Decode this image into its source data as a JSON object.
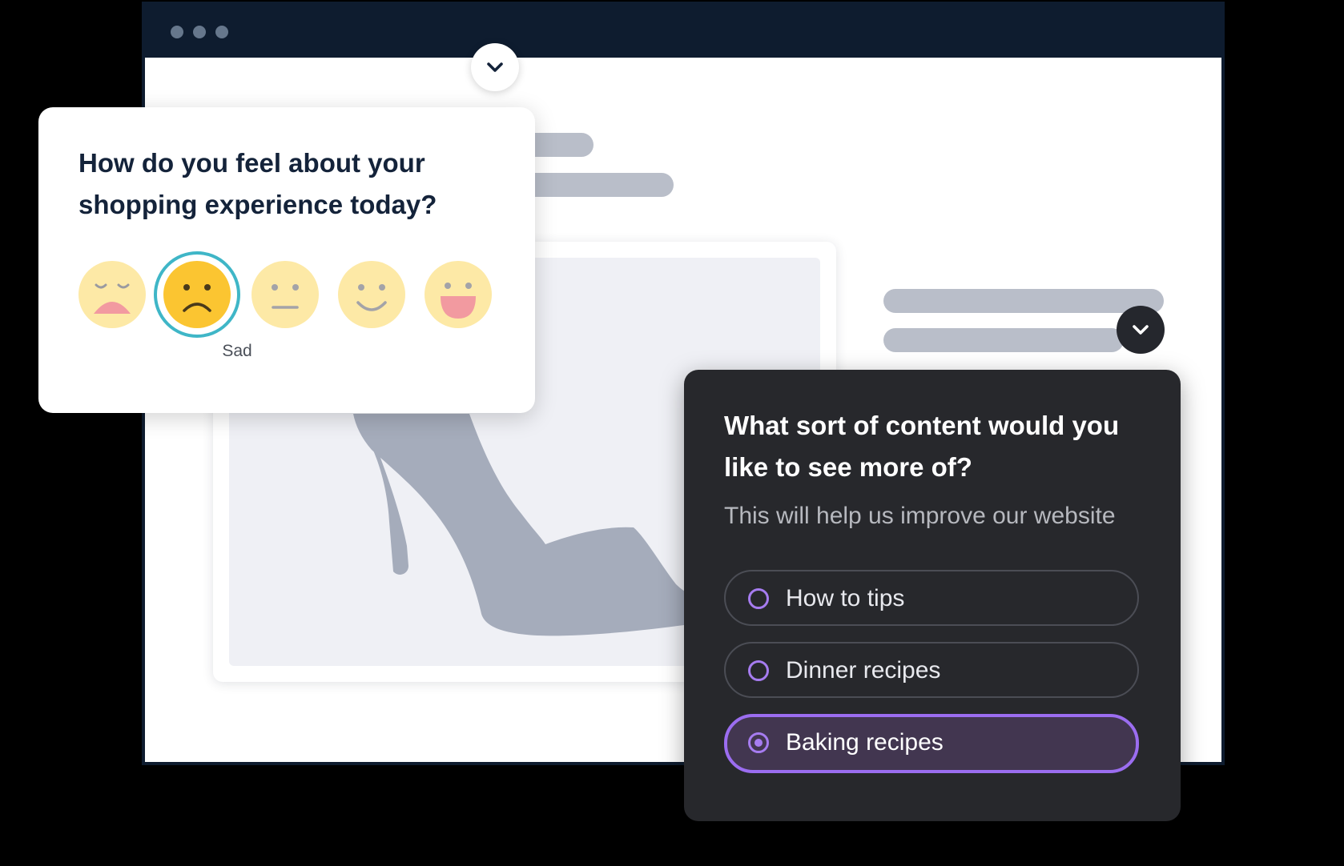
{
  "browser": {
    "window_dots": [
      "dot-1",
      "dot-2",
      "dot-3"
    ]
  },
  "icons": {
    "expand_light": "chevron-down-icon",
    "expand_dark": "chevron-down-icon"
  },
  "mood_survey": {
    "question": "How do you feel about your shopping experience today?",
    "options": [
      "very-sad",
      "sad",
      "neutral",
      "happy",
      "very-happy"
    ],
    "selected_index": 1,
    "selected_label": "Sad"
  },
  "content_survey": {
    "question": "What sort of content would you like to see more of?",
    "subtitle": "This will help us improve our website",
    "options": [
      {
        "label": "How to tips",
        "selected": false
      },
      {
        "label": "Dinner recipes",
        "selected": false
      },
      {
        "label": "Baking recipes",
        "selected": true
      }
    ]
  },
  "colors": {
    "browser_bar": "#0e1c2f",
    "selection_ring": "#3fb6c7",
    "accent_purple": "#9b6df0",
    "dark_card": "#27282c"
  }
}
